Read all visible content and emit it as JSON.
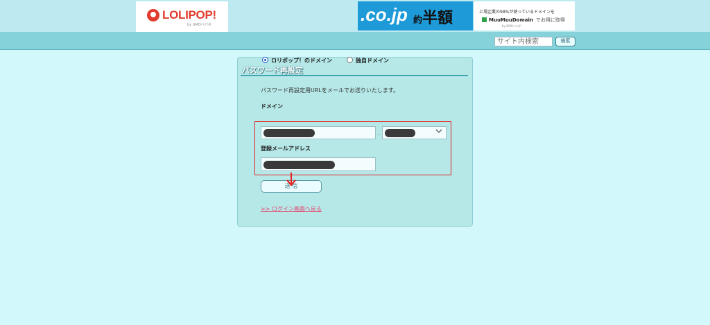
{
  "header": {
    "logo_text": "LOLIPOP!",
    "logo_sub": "by GMOペパボ",
    "ad": {
      "cojp": ".co.jp",
      "discount_small": "約",
      "discount": "半額",
      "line1": "上場企業の98%が使っているドメインを",
      "brand": "MuuMuuDomain",
      "brand_tail": "でお得に取得",
      "gmo": "by GMOペパボ"
    }
  },
  "search": {
    "placeholder": "サイト内検索",
    "button_label": "検索"
  },
  "panel": {
    "title": "パスワード再設定",
    "description": "パスワード再設定用URLをメールでお送りいたします。",
    "domain_label": "ドメイン",
    "radio_options": [
      {
        "label": "ロリポップ！のドメイン",
        "selected": true
      },
      {
        "label": "独自ドメイン",
        "selected": false
      }
    ],
    "domain_separator": ".",
    "email_label": "登録メールアドレス",
    "submit_label": "送 信",
    "back_link": ">>  ログイン画面へ戻る"
  },
  "colors": {
    "page_bg": "#d3f8fc",
    "panel_bg": "#b6e8e8",
    "annotation_red": "#e22525",
    "link_pink": "#e6466e"
  }
}
